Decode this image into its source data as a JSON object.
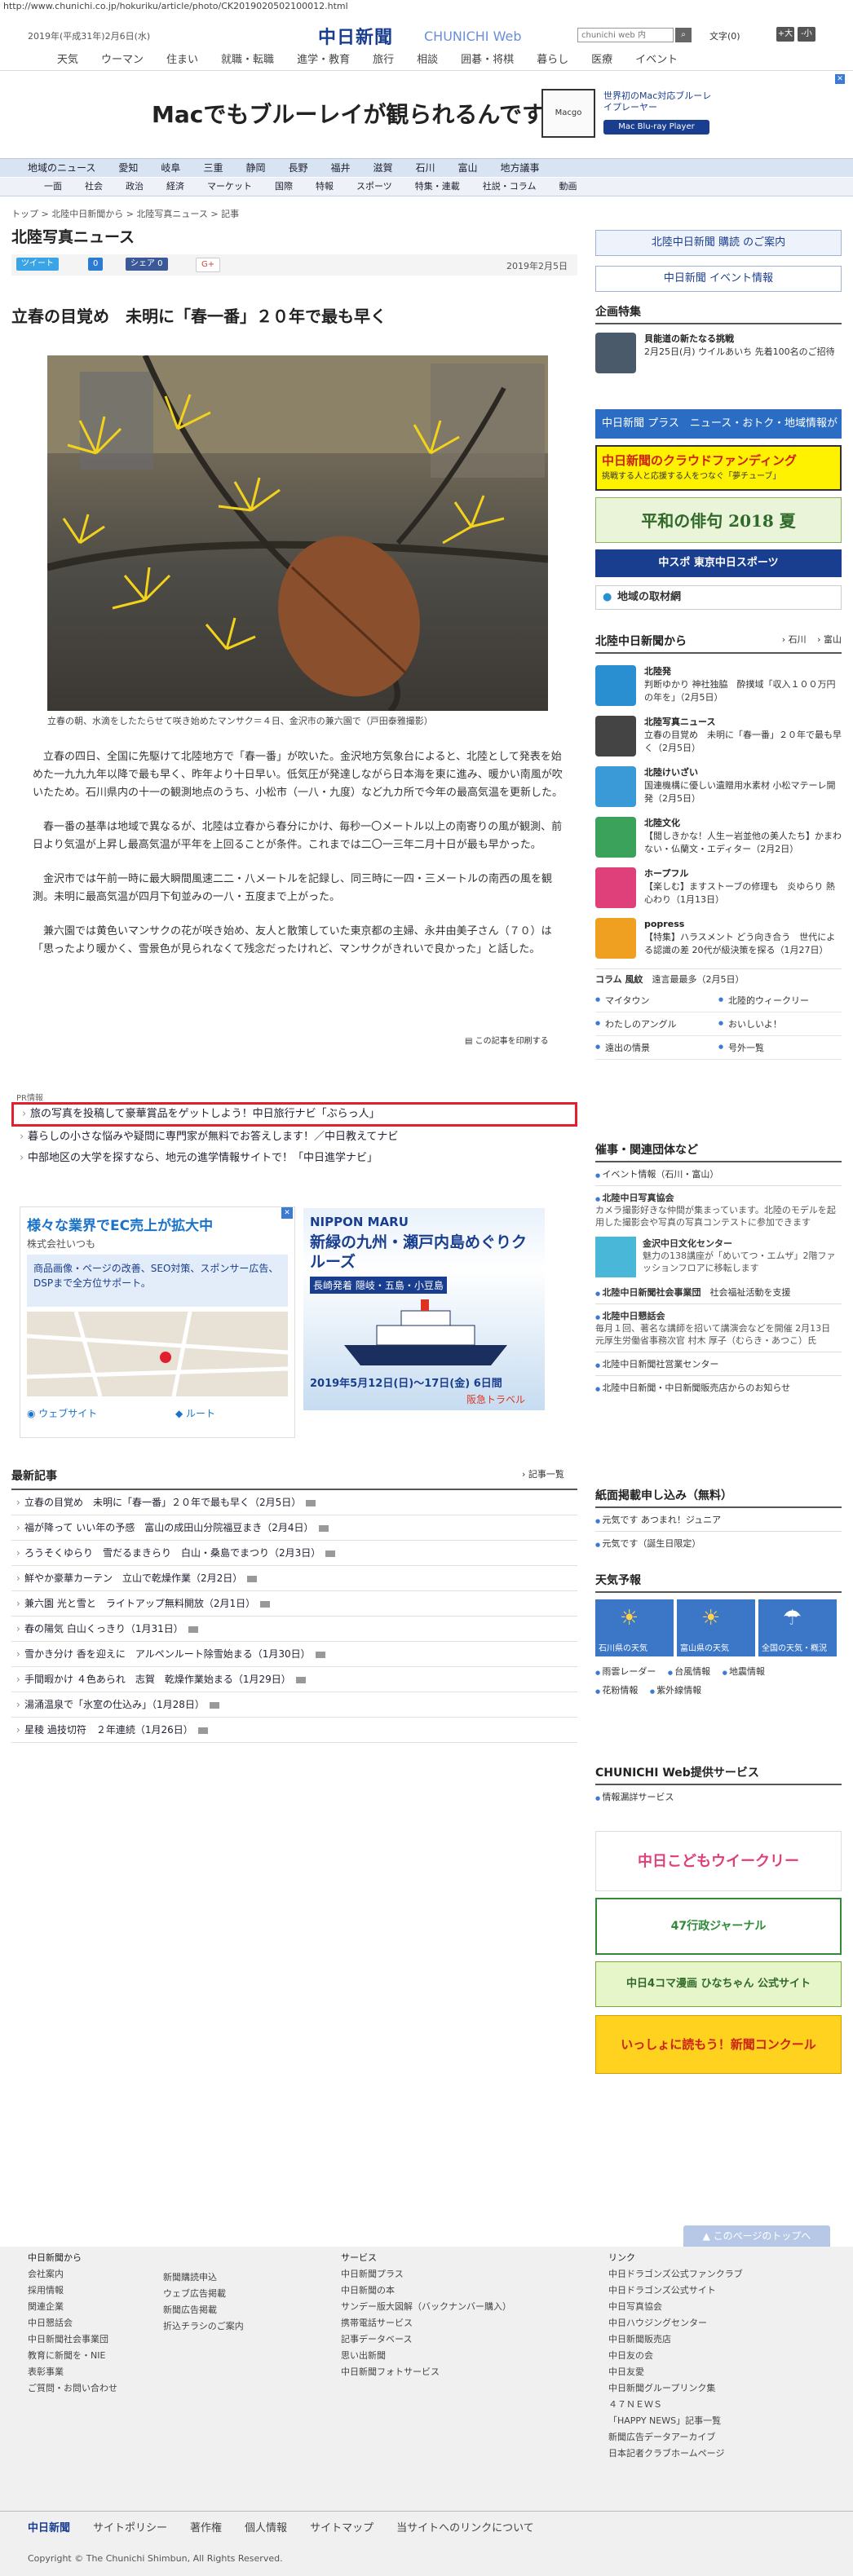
{
  "url": "http://www.chunichi.co.jp/hokuriku/article/photo/CK2019020502100012.html",
  "header": {
    "date": "2019年(平成31年)2月6日(水)",
    "logo_main": "中日新聞",
    "logo_sub": "CHUNICHI Web",
    "search_placeholder": "chunichi web 内",
    "search_button": "検索",
    "font_label": "文字",
    "font_current": "(0)",
    "font_bigger": "+大",
    "font_smaller": "-小",
    "nav": [
      "天気",
      "ウーマン",
      "住まい",
      "就職・転職",
      "進学・教育",
      "旅行",
      "相談",
      "囲碁・将棋",
      "暮らし",
      "医療",
      "イベント"
    ]
  },
  "top_ad": {
    "text": "Macでもブルーレイが観られるんです。",
    "product": "Macgo",
    "promo": "世界初のMac対応ブルーレイプレーヤー",
    "button": "Mac Blu-ray Player"
  },
  "catnav1": [
    "地域のニュース",
    "愛知",
    "岐阜",
    "三重",
    "静岡",
    "長野",
    "福井",
    "滋賀",
    "石川",
    "富山",
    "地方議事"
  ],
  "catnav2": [
    "一面",
    "社会",
    "政治",
    "経済",
    "マーケット",
    "国際",
    "特報",
    "スポーツ",
    "特集・連載",
    "社説・コラム",
    "動画"
  ],
  "article": {
    "breadcrumb": "トップ > 北陸中日新聞から > 北陸写真ニュース > 記事",
    "section": "北陸写真ニュース",
    "share": [
      "ツイート",
      "0",
      "シェア 0",
      "G+"
    ],
    "date": "2019年2月5日",
    "headline": "立春の目覚め　未明に「春一番」２０年で最も早く",
    "caption": "立春の朝、水滴をしたたらせて咲き始めたマンサク＝４日、金沢市の兼六園で（戸田泰雅撮影）",
    "paragraphs": [
      "立春の四日、全国に先駆けて北陸地方で「春一番」が吹いた。金沢地方気象台によると、北陸として発表を始めた一九九九年以降で最も早く、昨年より十日早い。低気圧が発達しながら日本海を東に進み、暖かい南風が吹いたため。石川県内の十一の観測地点のうち、小松市（一八・九度）など九カ所で今年の最高気温を更新した。",
      "春一番の基準は地域で異なるが、北陸は立春から春分にかけ、毎秒一〇メートル以上の南寄りの風が観測、前日より気温が上昇し最高気温が平年を上回ることが条件。これまでは二〇一三年二月十日が最も早かった。",
      "金沢市では午前一時に最大瞬間風速二二・八メートルを記録し、同三時に一四・三メートルの南西の風を観測。未明に最高気温が四月下旬並みの一八・五度まで上がった。",
      "兼六園では黄色いマンサクの花が咲き始め、友人と散策していた東京都の主婦、永井由美子さん（７０）は「思ったより暖かく、雪景色が見られなくて残念だったけれど、マンサクがきれいで良かった」と話した。"
    ],
    "print_link": "この記事を印刷する"
  },
  "pr": {
    "label": "PR情報",
    "items": [
      "旅の写真を投稿して豪華賞品をゲットしよう！中日旅行ナビ「ぶらっ人」",
      "暮らしの小さな悩みや疑問に専門家が無料でお答えします！／中日教えてナビ",
      "中部地区の大学を探すなら、地元の進学情報サイトで！「中日進学ナビ」"
    ]
  },
  "ad_left": {
    "title": "様々な業界でEC売上が拡大中",
    "company": "株式会社いつも",
    "body": "商品画像・ページの改善、SEO対策、スポンサー広告、DSPまで全方位サポート。",
    "website": "ウェブサイト",
    "route": "ルート"
  },
  "ad_right": {
    "brand": "NIPPON MARU",
    "headline": "新緑の九州・瀬戸内島めぐりクルーズ",
    "ports": "長崎発着 隠岐・五島・小豆島",
    "dates": "2019年5月12日(日)〜17日(金) 6日間",
    "agency": "阪急トラベル"
  },
  "latest": {
    "title": "最新記事",
    "more": "記事一覧",
    "items": [
      "立春の目覚め　未明に「春一番」２０年で最も早く（2月5日）",
      "福が降って いい年の予感　富山の成田山分院福豆まき（2月4日）",
      "ろうそくゆらり　雪だるまきらり　白山・桑島でまつり（2月3日）",
      "鮮やか豪華カーテン　立山で乾燥作業（2月2日）",
      "兼六園 光と雪と　ライトアップ無料開放（2月1日）",
      "春の陽気 白山くっきり（1月31日）",
      "雪かき分け 香を迎えに　アルペンルート除雪始まる（1月30日）",
      "手間暇かけ ４色あられ　志賀　乾燥作業始まる（1月29日）",
      "湯涌温泉で「氷室の仕込み」（1月28日）",
      "星稜 過技切符　２年連続（1月26日）"
    ]
  },
  "sidebar": {
    "subscribe": "北陸中日新聞 購読 のご案内",
    "events": "中日新聞 イベント情報",
    "kikaku_title": "企画特集",
    "kikaku_name": "貝能道の新たなる挑戦",
    "kikaku_sub": "2月25日(月) ウイルあいち 先着100名のご招待",
    "plus": "中日新聞 プラス　ニュース・おトク・地域情報がいっぱい",
    "crowdfund": "中日新聞のクラウドファンディング",
    "crowdfund_sub": "挑戦する人と応援する人をつなぐ「夢チューブ」",
    "haiku": "平和の俳句 2018 夏",
    "tokyo": "中スポ 東京中日スポーツ",
    "chiiki": "地域の取材網",
    "from_title": "北陸中日新聞から",
    "from_links": [
      "石川",
      "富山"
    ],
    "from_items": [
      {
        "name": "北陸発",
        "text": "判断ゆかり 神社独脇　酔撲域「収入１００万円の年を」（2月5日）",
        "color": "#2a8fd1"
      },
      {
        "name": "北陸写真ニュース",
        "text": "立春の目覚め　未明に「春一番」２０年で最も早く（2月5日）",
        "color": "#444444"
      },
      {
        "name": "北陸けいざい",
        "text": "国連機構に優しい遺贈用水素材 小松マテーレ開発（2月5日）",
        "color": "#3a9ad8"
      },
      {
        "name": "北陸文化",
        "text": "【閲しきかな！人生ー岩並他の美人たち】かまわない・仏蘭文・エディター（2月2日）",
        "color": "#3aa25a"
      },
      {
        "name": "ホープフル",
        "text": "【楽しむ】ますストーブの修理も　炎ゆらり 熱心わり（1月13日）",
        "color": "#e0407a"
      },
      {
        "name": "popress",
        "text": "【特集】ハラスメント どう向き合う　世代による認識の差 20代が級決策を探る（1月27日）",
        "color": "#f0a020"
      }
    ],
    "column_label": "コラム 風紋",
    "column_link": "遠言最最多（2月5日）",
    "grid": [
      "マイタウン",
      "北陸的ウィークリー",
      "わたしのアングル",
      "おいしいよ！",
      "遠出の情景",
      "号外一覧"
    ],
    "sponsor_title": "催事・関連団体など",
    "sponsor_sub": "イベント情報（石川・富山）",
    "sponsor_items": [
      {
        "name": "北陸中日写真協会",
        "text": "カメラ撮影好きな仲間が集まっています。北陸のモデルを起用した撮影会や写真の写真コンテストに参加できます"
      },
      {
        "name": "金沢中日文化センター",
        "text": "魅力の138講座が「めいてつ・エムザ」2階ファッションフロアに移転します"
      },
      {
        "name": "北陸中日新聞社会事業団",
        "text": "社会福祉活動を支援"
      },
      {
        "name": "北陸中日懇話会",
        "text": "毎月１回、著名な講師を招いて講演会などを開催 2月13日 元厚生労働省事務次官 村木 厚子（むらき・あつこ）氏"
      },
      {
        "name": "北陸中日新聞社営業センター",
        "text": ""
      },
      {
        "name": "北陸中日新聞・中日新聞販売店からのお知らせ",
        "text": ""
      }
    ],
    "paper_title": "紙面掲載申し込み（無料）",
    "paper_items": [
      "元気です あつまれ！ジュニア",
      "元気です（誕生日限定）"
    ],
    "weather_title": "天気予報",
    "weather_tiles": [
      "石川県の天気",
      "富山県の天気",
      "全国の天気・概況"
    ],
    "weather_links": [
      "雨雲レーダー",
      "台風情報",
      "地震情報",
      "花粉情報",
      "紫外線情報"
    ],
    "service_title": "CHUNICHI Web提供サービス",
    "service_link": "情報漏詳サービス",
    "banners": [
      "中日こどもウイークリー",
      "47行政ジャーナル",
      "中日4コマ漫画 ひなちゃん 公式サイト",
      "いっしょに読もう！新聞コンクール"
    ]
  },
  "footer": {
    "top_button": "このページのトップへ",
    "col1_title": "中日新聞から",
    "col1": [
      "会社案内",
      "採用情報",
      "関連企業",
      "中日懇話会",
      "中日新聞社会事業団",
      "教育に新聞を・NIE",
      "表彰事業",
      "ご質問・お問い合わせ"
    ],
    "col2": [
      "新聞購読申込",
      "ウェブ広告掲載",
      "新聞広告掲載",
      "折込チラシのご案内"
    ],
    "col3_title": "サービス",
    "col3": [
      "中日新聞プラス",
      "中日新聞の本",
      "サンデー版大図解（バックナンバー購入）",
      "携帯電話サービス",
      "記事データベース",
      "思い出新聞",
      "中日新聞フォトサービス"
    ],
    "col4_title": "リンク",
    "col4": [
      "中日ドラゴンズ公式ファンクラブ",
      "中日ドラゴンズ公式サイト",
      "中日写真協会",
      "中日ハウジングセンター",
      "中日新聞販売店",
      "中日友の会",
      "中日友愛",
      "中日新聞グループリンク集",
      "４７ＮＥＷＳ",
      "「HAPPY NEWS」記事一覧",
      "新聞広告データアーカイブ",
      "日本記者クラブホームページ"
    ],
    "bar": [
      "中日新聞",
      "サイトポリシー",
      "著作権",
      "個人情報",
      "サイトマップ",
      "当サイトへのリンクについて"
    ],
    "copyright": "Copyright © The Chunichi Shimbun, All Rights Reserved."
  },
  "colors": {
    "brand": "#1a3e8f",
    "highlight": "#e0202c",
    "nav_bg": "#d9e4f2"
  }
}
